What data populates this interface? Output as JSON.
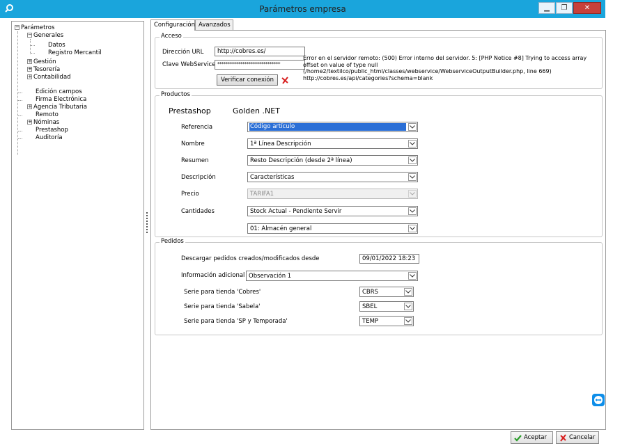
{
  "window": {
    "title": "Parámetros empresa"
  },
  "tree": {
    "root": "Parámetros",
    "items": [
      {
        "label": "Generales",
        "expanded": true
      },
      {
        "label": "Datos"
      },
      {
        "label": "Registro Mercantil"
      },
      {
        "label": "Gestión",
        "collapsed": true
      },
      {
        "label": "Tesorería",
        "collapsed": true
      },
      {
        "label": "Contabilidad",
        "collapsed": true
      },
      {
        "label": "Edición campos"
      },
      {
        "label": "Firma Electrónica"
      },
      {
        "label": "Agencia Tributaria",
        "collapsed": true
      },
      {
        "label": "Remoto"
      },
      {
        "label": "Nóminas",
        "collapsed": true
      },
      {
        "label": "Prestashop",
        "selected": true
      },
      {
        "label": "Auditoría"
      }
    ]
  },
  "tabs": [
    {
      "label": "Configuración",
      "active": true
    },
    {
      "label": "Avanzados"
    }
  ],
  "acceso": {
    "title": "Acceso",
    "url_label": "Dirección URL",
    "url_value": "http://cobres.es/",
    "key_label": "Clave WebService",
    "key_value": "******************************",
    "verify_label": "Verificar conexión",
    "error_lines": [
      "Error en el servidor remoto: (500) Error interno del servidor. 5: [PHP Notice #8] Trying to access array",
      "offset on value of type null",
      "(/home2/textilco/public_html/classes/webservice/WebserviceOutputBuilder.php, line 669)",
      "http://cobres.es/api/categories?schema=blank"
    ]
  },
  "productos": {
    "title": "Productos",
    "col_left": "Prestashop",
    "col_right": "Golden .NET",
    "rows": [
      {
        "label": "Referencia",
        "value": "Código artículo",
        "highlight": true
      },
      {
        "label": "Nombre",
        "value": "1ª Línea Descripción"
      },
      {
        "label": "Resumen",
        "value": "Resto Descripción (desde 2ª línea)"
      },
      {
        "label": "Descripción",
        "value": "Características"
      },
      {
        "label": "Precio",
        "value": "TARIFA1",
        "disabled": true
      },
      {
        "label": "Cantidades",
        "value": "Stock Actual - Pendiente Servir"
      },
      {
        "label": "",
        "value": "01: Almacén general"
      }
    ]
  },
  "pedidos": {
    "title": "Pedidos",
    "download_label": "Descargar pedidos creados/modificados desde",
    "download_value": "09/01/2022 18:23",
    "info_label": "Información adicional",
    "info_value": "Observación 1",
    "series": [
      {
        "label": "Serie para tienda 'Cobres'",
        "value": "CBRS"
      },
      {
        "label": "Serie para tienda 'Sabela'",
        "value": "SBEL"
      },
      {
        "label": "Serie para tienda 'SP y Temporada'",
        "value": "TEMP"
      }
    ]
  },
  "buttons": {
    "accept": "Aceptar",
    "cancel": "Cancelar"
  }
}
